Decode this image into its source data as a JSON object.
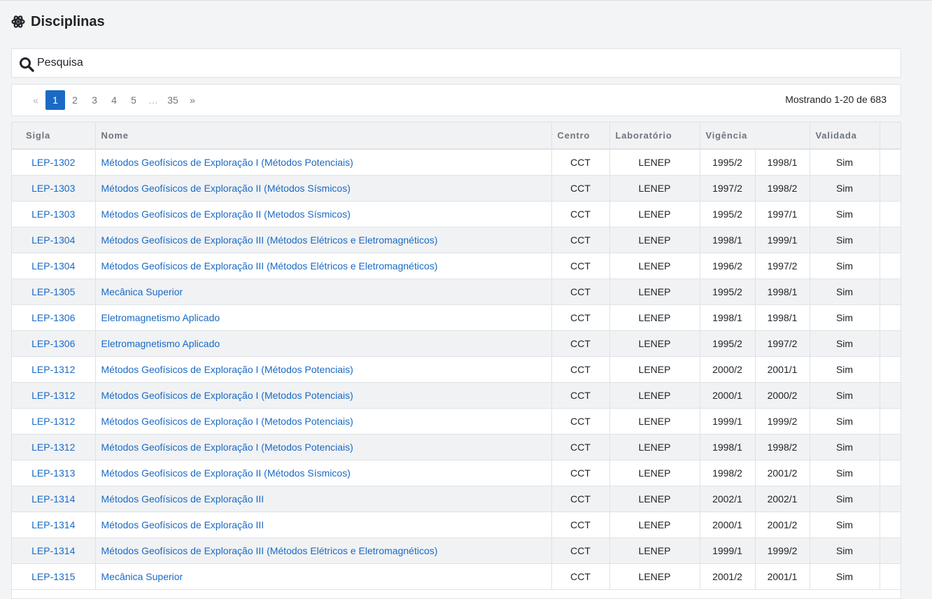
{
  "header": {
    "title": "Disciplinas",
    "icon": "atom-icon"
  },
  "search": {
    "placeholder": "Pesquisa",
    "icon": "search-icon"
  },
  "pagination": {
    "prev": "«",
    "pages": [
      "1",
      "2",
      "3",
      "4",
      "5"
    ],
    "ellipsis": "…",
    "last": "35",
    "next": "»",
    "current": "1",
    "showing": "Mostrando 1-20 de 683"
  },
  "table": {
    "headers": {
      "sigla": "Sigla",
      "nome": "Nome",
      "centro": "Centro",
      "laboratorio": "Laboratório",
      "vigencia": "Vigência",
      "validada": "Validada"
    },
    "rows": [
      [
        "LEP-1302",
        "Métodos Geofísicos de Exploração I (Métodos Potenciais)",
        "CCT",
        "LENEP",
        "1995/2",
        "1998/1",
        "Sim"
      ],
      [
        "LEP-1303",
        "Métodos Geofísicos de Exploração II (Métodos Sísmicos)",
        "CCT",
        "LENEP",
        "1997/2",
        "1998/2",
        "Sim"
      ],
      [
        "LEP-1303",
        "Métodos Geofísicos de Exploração II (Metodos Sísmicos)",
        "CCT",
        "LENEP",
        "1995/2",
        "1997/1",
        "Sim"
      ],
      [
        "LEP-1304",
        "Métodos Geofísicos de Exploração III (Métodos Elétricos e Eletromagnéticos)",
        "CCT",
        "LENEP",
        "1998/1",
        "1999/1",
        "Sim"
      ],
      [
        "LEP-1304",
        "Métodos Geofísicos de Exploração III (Métodos Elétricos e Eletromagnéticos)",
        "CCT",
        "LENEP",
        "1996/2",
        "1997/2",
        "Sim"
      ],
      [
        "LEP-1305",
        "Mecânica Superior",
        "CCT",
        "LENEP",
        "1995/2",
        "1998/1",
        "Sim"
      ],
      [
        "LEP-1306",
        "Eletromagnetismo Aplicado",
        "CCT",
        "LENEP",
        "1998/1",
        "1998/1",
        "Sim"
      ],
      [
        "LEP-1306",
        "Eletromagnetismo Aplicado",
        "CCT",
        "LENEP",
        "1995/2",
        "1997/2",
        "Sim"
      ],
      [
        "LEP-1312",
        "Métodos Geofísicos de Exploração I (Métodos Potenciais)",
        "CCT",
        "LENEP",
        "2000/2",
        "2001/1",
        "Sim"
      ],
      [
        "LEP-1312",
        "Métodos Geofísicos de Exploração I (Metodos Potenciais)",
        "CCT",
        "LENEP",
        "2000/1",
        "2000/2",
        "Sim"
      ],
      [
        "LEP-1312",
        "Métodos Geofísicos de Exploração I (Metodos Potenciais)",
        "CCT",
        "LENEP",
        "1999/1",
        "1999/2",
        "Sim"
      ],
      [
        "LEP-1312",
        "Métodos Geofísicos de Exploração I (Metodos Potenciais)",
        "CCT",
        "LENEP",
        "1998/1",
        "1998/2",
        "Sim"
      ],
      [
        "LEP-1313",
        "Métodos Geofísicos de Exploração II (Métodos Sísmicos)",
        "CCT",
        "LENEP",
        "1998/2",
        "2001/2",
        "Sim"
      ],
      [
        "LEP-1314",
        "Métodos Geofísicos de Exploração III",
        "CCT",
        "LENEP",
        "2002/1",
        "2002/1",
        "Sim"
      ],
      [
        "LEP-1314",
        "Métodos Geofísicos de Exploração III",
        "CCT",
        "LENEP",
        "2000/1",
        "2001/2",
        "Sim"
      ],
      [
        "LEP-1314",
        "Métodos Geofísicos de Exploração III (Métodos Elétricos e Eletromagnéticos)",
        "CCT",
        "LENEP",
        "1999/1",
        "1999/2",
        "Sim"
      ],
      [
        "LEP-1315",
        "Mecânica Superior",
        "CCT",
        "LENEP",
        "2001/2",
        "2001/1",
        "Sim"
      ]
    ]
  },
  "colors": {
    "accent": "#1a6ac4",
    "stripe": "#f1f2f4",
    "border": "#dee2e6"
  }
}
